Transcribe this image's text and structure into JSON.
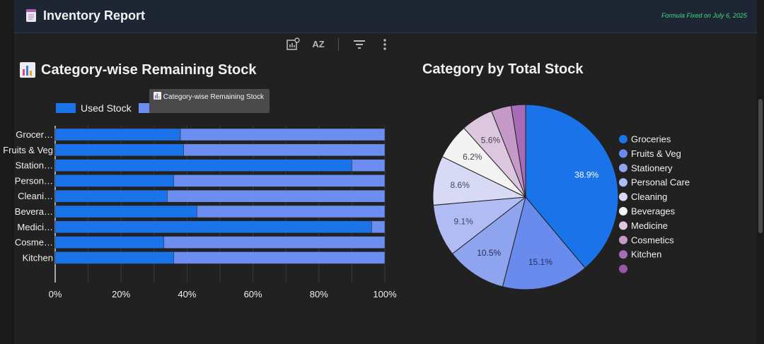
{
  "header": {
    "title": "Inventory Report",
    "note": "Formula Fixed on July 6, 2025"
  },
  "toolbar": {
    "icons": [
      "insert-chart-icon",
      "sort-az-icon",
      "filter-icon",
      "more-vert-icon"
    ],
    "sort_label": "AZ"
  },
  "bar_chart": {
    "title": "Category-wise Remaining Stock",
    "legend_used": "Used Stock",
    "tooltip": "Category-wise Remaining Stock"
  },
  "pie_chart": {
    "title": "Category by Total Stock"
  },
  "colors": {
    "used": "#1a73e8",
    "remaining": "#6c8ef0"
  },
  "chart_data": [
    {
      "type": "bar",
      "orientation": "horizontal",
      "stacked": "percent",
      "title": "Category-wise Remaining Stock",
      "categories": [
        "Grocer…",
        "Fruits & Veg",
        "Station…",
        "Person…",
        "Cleani…",
        "Bevera…",
        "Medici…",
        "Cosme…",
        "Kitchen"
      ],
      "series": [
        {
          "name": "Used Stock",
          "values": [
            38,
            39,
            90,
            36,
            34,
            43,
            96,
            33,
            36
          ]
        },
        {
          "name": "",
          "values": [
            62,
            61,
            10,
            64,
            66,
            57,
            4,
            67,
            64
          ]
        }
      ],
      "xlim": [
        0,
        100
      ],
      "xticks": [
        "0%",
        "20%",
        "40%",
        "60%",
        "80%",
        "100%"
      ],
      "grid": true,
      "legend": "top"
    },
    {
      "type": "pie",
      "title": "Category by Total Stock",
      "labels": [
        "Groceries",
        "Fruits & Veg",
        "Stationery",
        "Personal Care",
        "Cleaning",
        "Beverages",
        "Medicine",
        "Cosmetics",
        "Kitchen",
        ""
      ],
      "values": [
        38.9,
        15.1,
        10.5,
        9.1,
        8.6,
        6.2,
        5.6,
        3.5,
        2.5,
        0
      ],
      "display_labels": [
        "38.9%",
        "15.1%",
        "10.5%",
        "9.1%",
        "8.6%",
        "6.2%",
        "5.6%",
        "",
        "",
        ""
      ],
      "colors": [
        "#1a73e8",
        "#6a8bee",
        "#8fa4ee",
        "#b0bcf3",
        "#d8daf5",
        "#f3f3f3",
        "#ddc7df",
        "#c59ac9",
        "#a86bb7",
        "#9657a8"
      ],
      "legend": "right"
    }
  ]
}
